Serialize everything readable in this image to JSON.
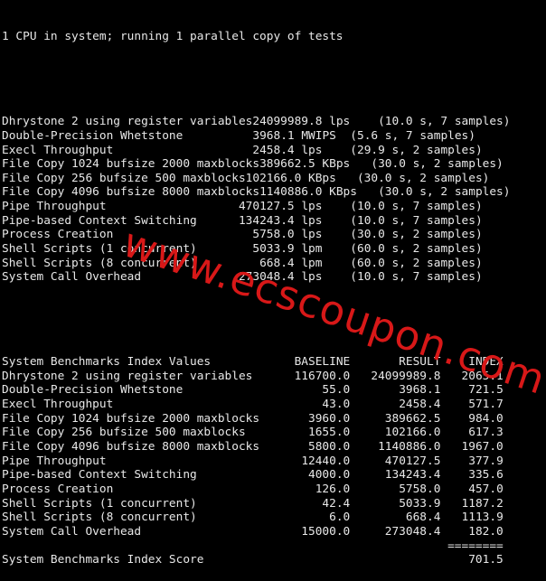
{
  "header": "1 CPU in system; running 1 parallel copy of tests",
  "test_results": [
    {
      "name": "Dhrystone 2 using register variables",
      "value": "24099989.8",
      "unit": "lps",
      "detail": "(10.0 s, 7 samples)"
    },
    {
      "name": "Double-Precision Whetstone",
      "value": "3968.1",
      "unit": "MWIPS",
      "detail": "(5.6 s, 7 samples)"
    },
    {
      "name": "Execl Throughput",
      "value": "2458.4",
      "unit": "lps",
      "detail": "(29.9 s, 2 samples)"
    },
    {
      "name": "File Copy 1024 bufsize 2000 maxblocks",
      "value": "389662.5",
      "unit": "KBps",
      "detail": "(30.0 s, 2 samples)"
    },
    {
      "name": "File Copy 256 bufsize 500 maxblocks",
      "value": "102166.0",
      "unit": "KBps",
      "detail": "(30.0 s, 2 samples)"
    },
    {
      "name": "File Copy 4096 bufsize 8000 maxblocks",
      "value": "1140886.0",
      "unit": "KBps",
      "detail": "(30.0 s, 2 samples)"
    },
    {
      "name": "Pipe Throughput",
      "value": "470127.5",
      "unit": "lps",
      "detail": "(10.0 s, 7 samples)"
    },
    {
      "name": "Pipe-based Context Switching",
      "value": "134243.4",
      "unit": "lps",
      "detail": "(10.0 s, 7 samples)"
    },
    {
      "name": "Process Creation",
      "value": "5758.0",
      "unit": "lps",
      "detail": "(30.0 s, 2 samples)"
    },
    {
      "name": "Shell Scripts (1 concurrent)",
      "value": "5033.9",
      "unit": "lpm",
      "detail": "(60.0 s, 2 samples)"
    },
    {
      "name": "Shell Scripts (8 concurrent)",
      "value": "668.4",
      "unit": "lpm",
      "detail": "(60.0 s, 2 samples)"
    },
    {
      "name": "System Call Overhead",
      "value": "273048.4",
      "unit": "lps",
      "detail": "(10.0 s, 7 samples)"
    }
  ],
  "index_table": {
    "title": "System Benchmarks Index Values",
    "col_baseline": "BASELINE",
    "col_result": "RESULT",
    "col_index": "INDEX",
    "rows": [
      {
        "name": "Dhrystone 2 using register variables",
        "baseline": "116700.0",
        "result": "24099989.8",
        "index": "2065.1"
      },
      {
        "name": "Double-Precision Whetstone",
        "baseline": "55.0",
        "result": "3968.1",
        "index": "721.5"
      },
      {
        "name": "Execl Throughput",
        "baseline": "43.0",
        "result": "2458.4",
        "index": "571.7"
      },
      {
        "name": "File Copy 1024 bufsize 2000 maxblocks",
        "baseline": "3960.0",
        "result": "389662.5",
        "index": "984.0"
      },
      {
        "name": "File Copy 256 bufsize 500 maxblocks",
        "baseline": "1655.0",
        "result": "102166.0",
        "index": "617.3"
      },
      {
        "name": "File Copy 4096 bufsize 8000 maxblocks",
        "baseline": "5800.0",
        "result": "1140886.0",
        "index": "1967.0"
      },
      {
        "name": "Pipe Throughput",
        "baseline": "12440.0",
        "result": "470127.5",
        "index": "377.9"
      },
      {
        "name": "Pipe-based Context Switching",
        "baseline": "4000.0",
        "result": "134243.4",
        "index": "335.6"
      },
      {
        "name": "Process Creation",
        "baseline": "126.0",
        "result": "5758.0",
        "index": "457.0"
      },
      {
        "name": "Shell Scripts (1 concurrent)",
        "baseline": "42.4",
        "result": "5033.9",
        "index": "1187.2"
      },
      {
        "name": "Shell Scripts (8 concurrent)",
        "baseline": "6.0",
        "result": "668.4",
        "index": "1113.9"
      },
      {
        "name": "System Call Overhead",
        "baseline": "15000.0",
        "result": "273048.4",
        "index": "182.0"
      }
    ],
    "separator": "========",
    "score_label": "System Benchmarks Index Score",
    "score_value": "701.5"
  },
  "watermark": "www.ecscoupon.com",
  "colors": {
    "background": "#000000",
    "text": "#e8e8e8",
    "watermark": "#d81818"
  }
}
